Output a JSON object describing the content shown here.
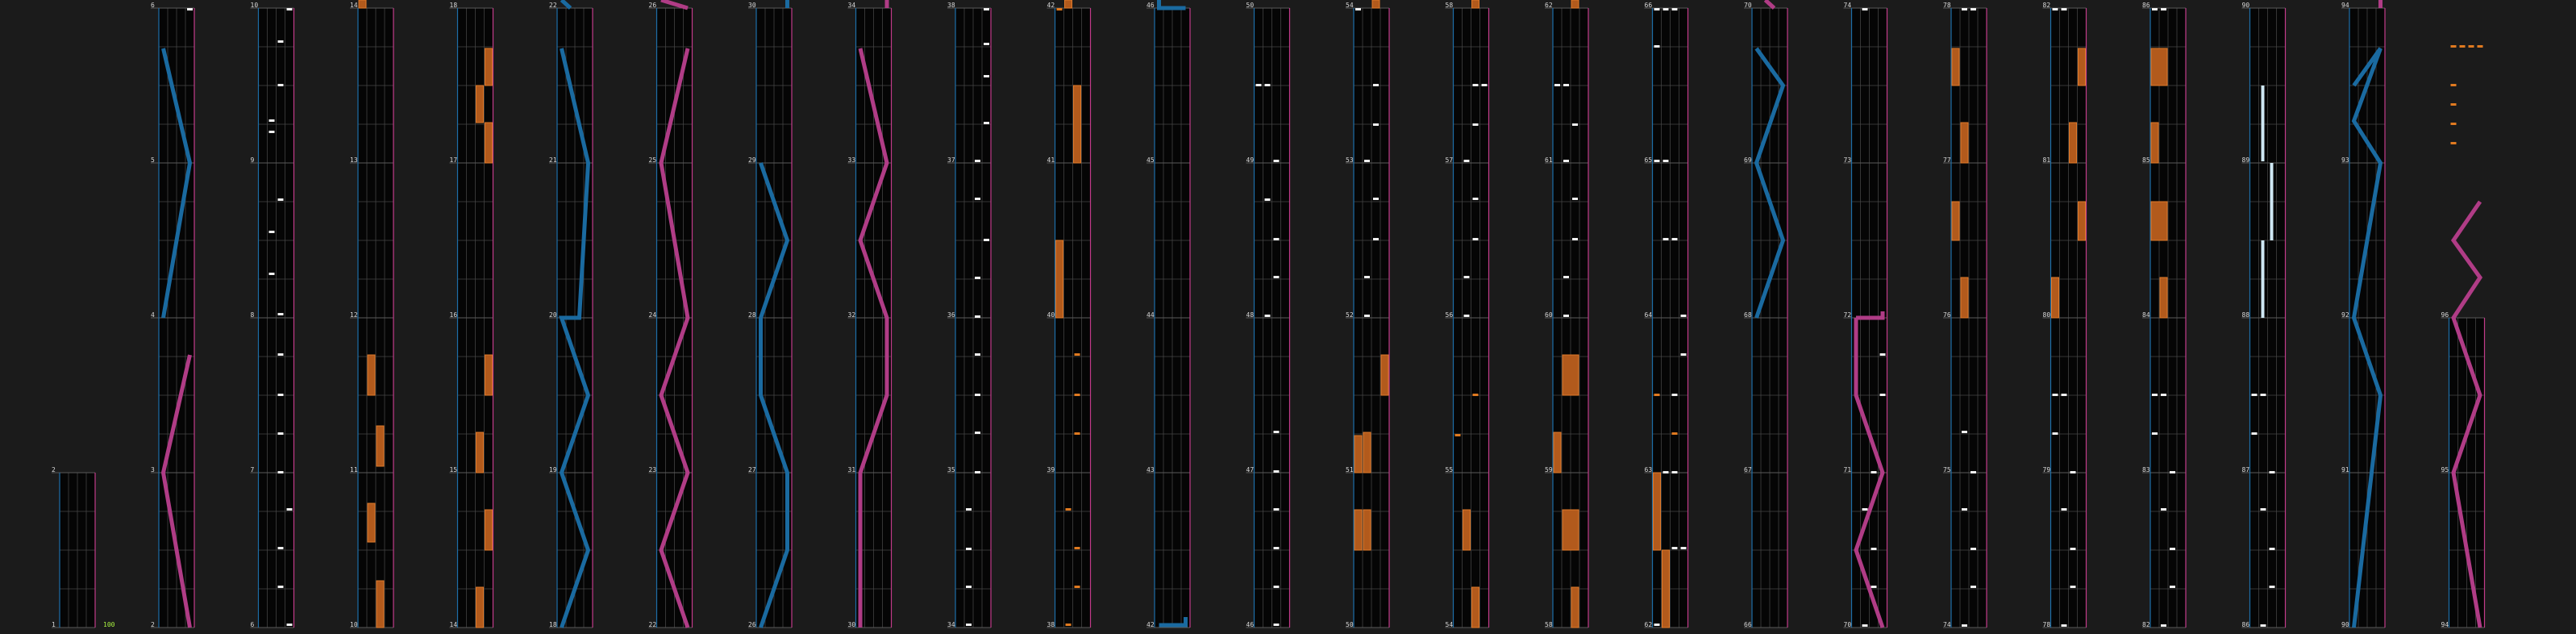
{
  "combo_label": "100",
  "colors": {
    "background": "#1b1b1b",
    "lane_fill": "#050505",
    "lane_left_border": "#1d6ea8",
    "lane_right_border": "#c23b8a",
    "grid": "#4a4a4a",
    "measure_line": "#5a5a5a",
    "blue_slide": "#1a6aa0",
    "pink_slide": "#b03c86",
    "hold": "#b25a1c",
    "hold_edge": "#e07a2a",
    "tap": "#f0f0f0",
    "orange_tap": "#e07a20",
    "cyan_hold": "#cfe8f4",
    "combo": "#a8f040"
  },
  "chart_data": {
    "type": "rhythm-game-chart-preview",
    "lane_count": 4,
    "measure_count": 96,
    "measures_per_column": 4,
    "column_count": 24,
    "columns": [
      {
        "first_measure": 1
      },
      {
        "first_measure": 2
      },
      {
        "first_measure": 6
      },
      {
        "first_measure": 10
      },
      {
        "first_measure": 14
      },
      {
        "first_measure": 18
      },
      {
        "first_measure": 22
      },
      {
        "first_measure": 26
      },
      {
        "first_measure": 30
      },
      {
        "first_measure": 34
      },
      {
        "first_measure": 38
      },
      {
        "first_measure": 42
      },
      {
        "first_measure": 46
      },
      {
        "first_measure": 50
      },
      {
        "first_measure": 54
      },
      {
        "first_measure": 58
      },
      {
        "first_measure": 62
      },
      {
        "first_measure": 66
      },
      {
        "first_measure": 70
      },
      {
        "first_measure": 74
      },
      {
        "first_measure": 78
      },
      {
        "first_measure": 82
      },
      {
        "first_measure": 86
      },
      {
        "first_measure": 90
      },
      {
        "first_measure": 94
      }
    ]
  }
}
